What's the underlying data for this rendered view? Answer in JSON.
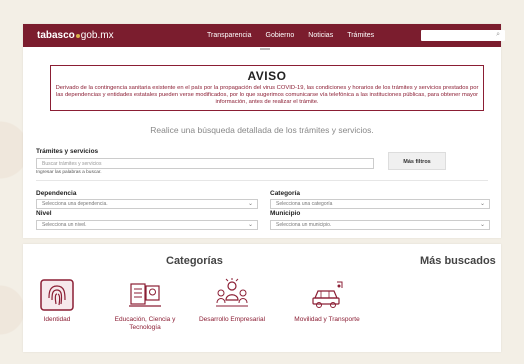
{
  "header": {
    "logo_main": "tabasco",
    "logo_suffix": "gob.mx",
    "nav": [
      "Transparencia",
      "Gobierno",
      "Noticias",
      "Trámites"
    ],
    "search_icon": "magnifier-icon"
  },
  "aviso": {
    "title": "AVISO",
    "text": "Derivado de la contingencia sanitaria existente en el país por la propagación del virus COVID-19, las condiciones y horarios de los trámites y servicios prestados por las dependencias y entidades estatales pueden verse modificados, por lo que sugerimos comunicarse vía telefónica a las instituciones públicas, para obtener mayor información, antes de realizar el trámite."
  },
  "search": {
    "tagline": "Realice una búsqueda detallada de los trámites y servicios.",
    "label": "Trámites y servicios",
    "placeholder": "Buscar trámites y servicios",
    "hint": "Ingresar las palabras a buscar.",
    "more_filters": "Más filtros"
  },
  "filters": {
    "dependencia_label": "Dependencia",
    "dependencia_value": "Selecciona una dependencia.",
    "categoria_label": "Categoría",
    "categoria_value": "Selecciona una categoría",
    "nivel_label": "Nivel",
    "nivel_value": "Selecciona un nivel.",
    "municipio_label": "Municipio",
    "municipio_value": "Selecciona un municipio."
  },
  "categories": {
    "title": "Categorías",
    "most_searched": "Más buscados",
    "items": [
      {
        "label": "Identidad",
        "icon": "fingerprint-icon"
      },
      {
        "label": "Educación, Ciencia y Tecnología",
        "icon": "education-icon"
      },
      {
        "label": "Desarrollo Empresarial",
        "icon": "business-icon"
      },
      {
        "label": "Movilidad y Transporte",
        "icon": "car-icon"
      }
    ]
  },
  "colors": {
    "brand": "#7b1d2e",
    "accent": "#8b1e34"
  }
}
